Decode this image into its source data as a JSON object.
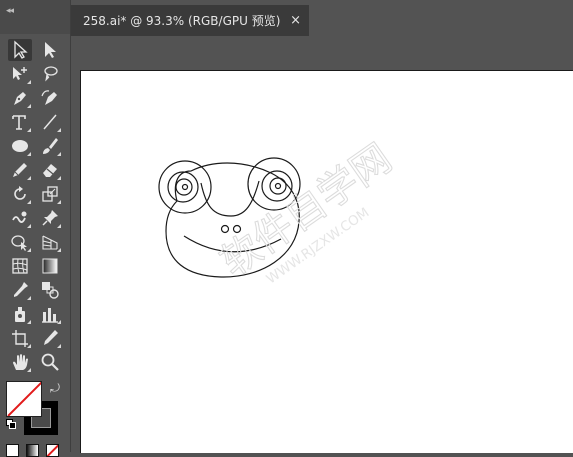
{
  "document": {
    "tab_title": "258.ai* @ 93.3% (RGB/GPU 预览)",
    "close_glyph": "×"
  },
  "tools": [
    {
      "name": "selection-tool",
      "icon": "arrow-outline-icon",
      "selected": true
    },
    {
      "name": "direct-selection-tool",
      "icon": "arrow-filled-icon"
    },
    {
      "name": "magic-wand-tool",
      "icon": "magic-wand-icon"
    },
    {
      "name": "lasso-tool",
      "icon": "lasso-icon"
    },
    {
      "name": "pen-tool",
      "icon": "pen-icon"
    },
    {
      "name": "curvature-tool",
      "icon": "curvature-pen-icon"
    },
    {
      "name": "type-tool",
      "icon": "type-icon"
    },
    {
      "name": "line-segment-tool",
      "icon": "line-icon"
    },
    {
      "name": "ellipse-tool",
      "icon": "ellipse-icon"
    },
    {
      "name": "paintbrush-tool",
      "icon": "paintbrush-icon"
    },
    {
      "name": "pencil-tool",
      "icon": "pencil-icon"
    },
    {
      "name": "eraser-tool",
      "icon": "eraser-icon"
    },
    {
      "name": "rotate-tool",
      "icon": "rotate-icon"
    },
    {
      "name": "scale-tool",
      "icon": "scale-icon"
    },
    {
      "name": "warp-tool",
      "icon": "warp-icon"
    },
    {
      "name": "puppet-warp-tool",
      "icon": "pin-icon"
    },
    {
      "name": "shape-builder-tool",
      "icon": "shape-builder-icon"
    },
    {
      "name": "perspective-grid-tool",
      "icon": "perspective-grid-icon"
    },
    {
      "name": "mesh-tool",
      "icon": "mesh-icon"
    },
    {
      "name": "gradient-tool",
      "icon": "gradient-icon"
    },
    {
      "name": "eyedropper-tool",
      "icon": "eyedropper-icon"
    },
    {
      "name": "blend-tool",
      "icon": "blend-icon"
    },
    {
      "name": "symbol-sprayer-tool",
      "icon": "symbol-sprayer-icon"
    },
    {
      "name": "column-graph-tool",
      "icon": "bar-graph-icon"
    },
    {
      "name": "artboard-tool",
      "icon": "artboard-icon"
    },
    {
      "name": "slice-tool",
      "icon": "slice-icon"
    },
    {
      "name": "hand-tool",
      "icon": "hand-icon"
    },
    {
      "name": "zoom-tool",
      "icon": "zoom-icon"
    }
  ],
  "colors": {
    "ui_background": "#535353",
    "tab_active": "#3a3a3a",
    "artboard": "#ffffff",
    "none_swatch_slash": "#e21b1b",
    "stroke_color": "#000000",
    "watermark": "#e2e2e2"
  },
  "watermark": {
    "text_line1": "软件自学网",
    "text_line2": "WWW.RJZXW.COM"
  }
}
